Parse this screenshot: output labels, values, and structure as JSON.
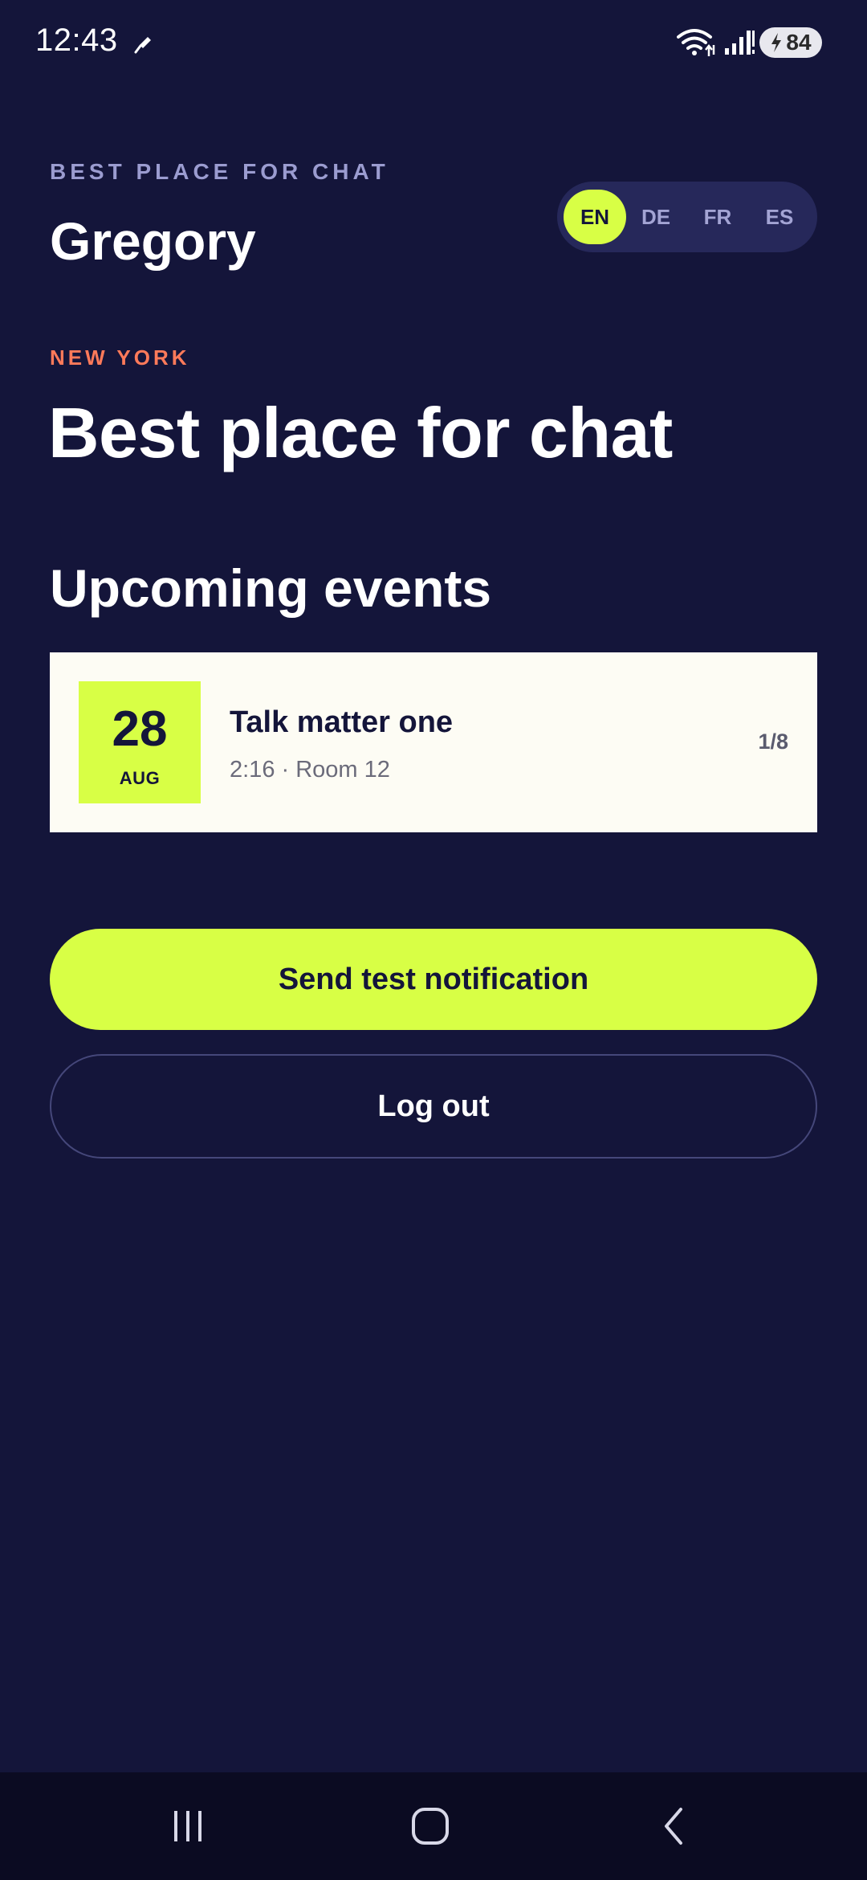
{
  "status_bar": {
    "time": "12:43",
    "battery": "84",
    "icons": [
      "mic-icon",
      "wifi-icon",
      "signal-icon",
      "battery-charging-icon"
    ]
  },
  "header": {
    "eyebrow": "BEST PLACE FOR CHAT",
    "user_name": "Gregory",
    "languages": [
      {
        "code": "EN",
        "active": true
      },
      {
        "code": "DE",
        "active": false
      },
      {
        "code": "FR",
        "active": false
      },
      {
        "code": "ES",
        "active": false
      }
    ]
  },
  "venue": {
    "city": "NEW YORK",
    "title": "Best place for chat"
  },
  "events": {
    "section_title": "Upcoming events",
    "items": [
      {
        "day": "28",
        "month": "AUG",
        "title": "Talk matter one",
        "meta": "2:16 · Room 12",
        "count": "1/8"
      }
    ]
  },
  "actions": {
    "primary_label": "Send test notification",
    "secondary_label": "Log out"
  },
  "nav": {
    "icons": [
      "recent-apps-icon",
      "home-icon",
      "back-icon"
    ]
  },
  "colors": {
    "background": "#14153a",
    "accent": "#d8ff45",
    "city": "#ff7a5a",
    "card": "#fdfcf4"
  }
}
